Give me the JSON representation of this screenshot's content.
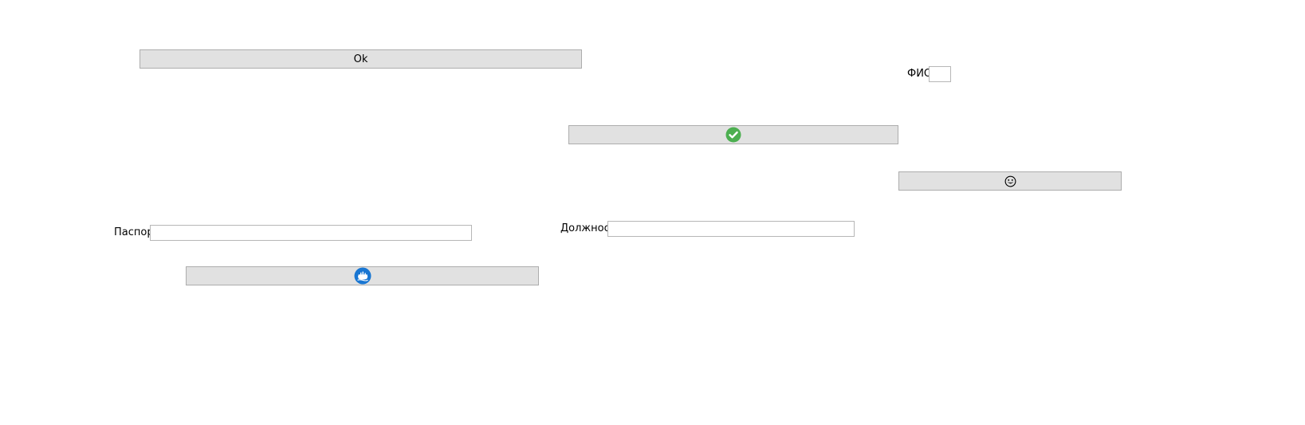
{
  "buttons": {
    "ok": {
      "label": "Ok"
    },
    "check": {
      "icon": "check-circle-icon",
      "color": "#4caf50"
    },
    "face": {
      "icon": "smiling-face-icon"
    },
    "ship": {
      "icon": "ship-icon",
      "color": "#1976d2"
    }
  },
  "fields": {
    "fio": {
      "label": "ФИО",
      "value": ""
    },
    "passport": {
      "label": "Паспорт",
      "value": ""
    },
    "position": {
      "label": "Должность",
      "value": ""
    }
  },
  "colors": {
    "button_face": "#e1e1e1",
    "button_border": "#adadad",
    "input_border": "#b7b7b7"
  }
}
